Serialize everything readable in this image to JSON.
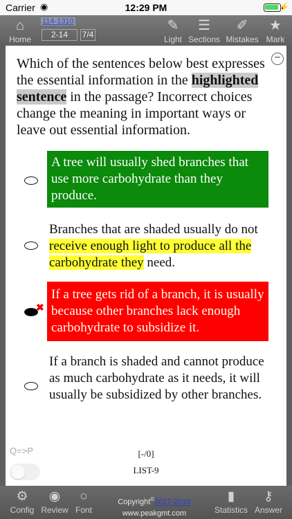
{
  "status": {
    "carrier": "Carrier",
    "time": "12:29 PM"
  },
  "toolbar": {
    "home": "Home",
    "progress_link": "114-1310",
    "range": "2-14",
    "position": "7/4",
    "light": "Light",
    "sections": "Sections",
    "mistakes": "Mistakes",
    "mark": "Mark"
  },
  "question": {
    "part1": "Which of the sentences below best expresses the essential information in the ",
    "highlight": "highlighted sentence",
    "part2": " in the passage? Incorrect choices change the meaning in important ways or leave out essential information."
  },
  "choices": [
    {
      "text": "A tree will usually shed branches that use more carbohydrate than they produce.",
      "state": "correct"
    },
    {
      "pre": "Branches that are shaded usually do not ",
      "hl": "receive enough light to produce all the carbohydrate they",
      "post": " need.",
      "state": "normal"
    },
    {
      "text": "If a tree gets rid of a branch, it is usually because other branches lack enough carbohydrate to subsidize it.",
      "state": "selected-wrong"
    },
    {
      "text": "If a branch is shaded and cannot produce as much carbohydrate as it needs, it will usually be subsidized by other branches.",
      "state": "normal"
    }
  ],
  "footer": {
    "qp_label": "Q=>P",
    "question_number": "[-/0]",
    "list_name": "LIST-9"
  },
  "bottom": {
    "config": "Config",
    "review": "Review",
    "font": "Font",
    "copyright_label": "Copyright",
    "copyright_years": "2017-2019",
    "website": "www.peakgmt.com",
    "statistics": "Statistics",
    "answer": "Answer"
  },
  "colors": {
    "correct": "#0b8a0b",
    "wrong": "#ff0000",
    "highlight": "#ffff33"
  }
}
